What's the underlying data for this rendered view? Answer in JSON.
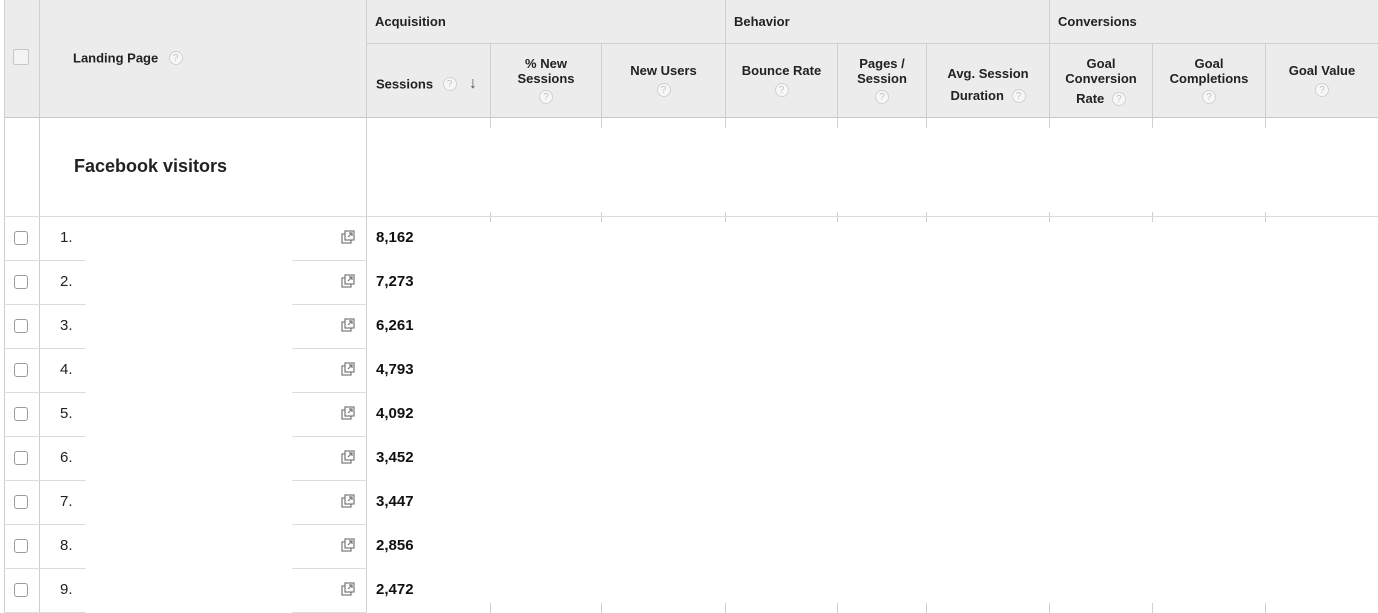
{
  "header": {
    "landing_page_label": "Landing Page",
    "groups": {
      "acquisition": "Acquisition",
      "behavior": "Behavior",
      "conversions": "Conversions"
    },
    "columns": {
      "sessions": "Sessions",
      "new_sessions_1": "% New",
      "new_sessions_2": "Sessions",
      "new_users": "New Users",
      "bounce_rate": "Bounce Rate",
      "pages_session_1": "Pages /",
      "pages_session_2": "Session",
      "avg_session_1": "Avg. Session",
      "avg_session_2": "Duration",
      "goal_conv_1": "Goal",
      "goal_conv_2": "Conversion",
      "goal_conv_3": "Rate",
      "goal_comp_1": "Goal",
      "goal_comp_2": "Completions",
      "goal_value": "Goal Value"
    },
    "help_glyph": "?",
    "sort_glyph": "↓"
  },
  "segment": {
    "label": "Facebook visitors"
  },
  "rows": [
    {
      "num": "1.",
      "sessions": "8,162"
    },
    {
      "num": "2.",
      "sessions": "7,273"
    },
    {
      "num": "3.",
      "sessions": "6,261"
    },
    {
      "num": "4.",
      "sessions": "4,793"
    },
    {
      "num": "5.",
      "sessions": "4,092"
    },
    {
      "num": "6.",
      "sessions": "3,452"
    },
    {
      "num": "7.",
      "sessions": "3,447"
    },
    {
      "num": "8.",
      "sessions": "2,856"
    },
    {
      "num": "9.",
      "sessions": "2,472"
    }
  ],
  "icons": {
    "row_link": "open-in-new-window-icon",
    "sort": "sort-descending-icon",
    "help": "help-icon"
  },
  "colors": {
    "header_bg": "#ececec",
    "grid": "#cfcfcf"
  }
}
